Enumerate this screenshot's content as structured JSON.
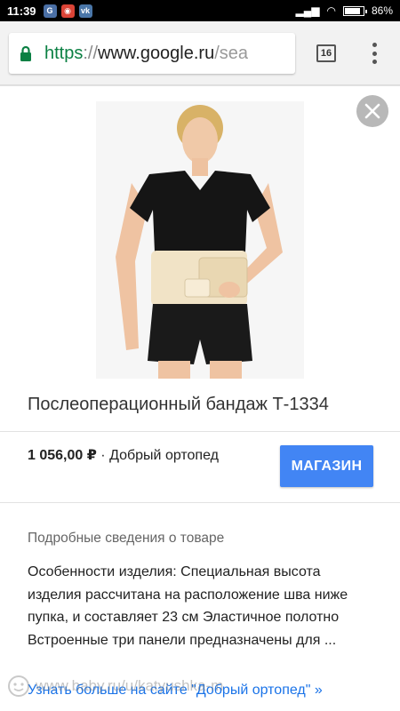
{
  "status_bar": {
    "time": "11:39",
    "battery": "86%",
    "battery_level": 0.86
  },
  "browser": {
    "url_scheme": "https",
    "url_sep": "://",
    "url_host": "www.google.ru",
    "url_path": "/sea",
    "tab_count": "16"
  },
  "product": {
    "title": "Послеоперационный бандаж Т-1334",
    "price": "1 056,00 ₽",
    "separator": " · ",
    "seller": "Добрый ортопед",
    "shop_button": "МАГАЗИН"
  },
  "details": {
    "heading": "Подробные сведения о товаре",
    "description": "Особенности изделия: Специальная высота изделия рассчитана на расположение шва ниже пупка, и составляет 23 см Эластичное полотно Встроенные три панели предназначены для ...",
    "more_link": "Узнать больше на сайте \"Добрый ортопед\" »"
  },
  "watermark": {
    "text": "www.baby.ru/u/katyushka-m"
  },
  "colors": {
    "accent": "#4285f4",
    "link": "#1a73e8",
    "secure": "#0b8043"
  }
}
